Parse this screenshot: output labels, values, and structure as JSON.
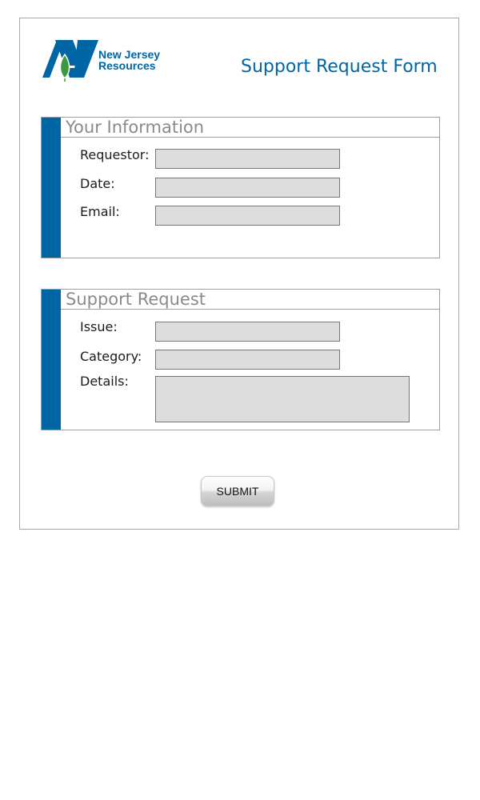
{
  "logo": {
    "line1": "New Jersey",
    "line2": "Resources",
    "brand_color": "#0065a4",
    "leaf_color": "#3a9a3d"
  },
  "page_title": "Support Request Form",
  "sections": {
    "your_information": {
      "title": "Your Information",
      "fields": {
        "requestor": {
          "label": "Requestor:",
          "value": ""
        },
        "date": {
          "label": "Date:",
          "value": ""
        },
        "email": {
          "label": "Email:",
          "value": ""
        }
      }
    },
    "support_request": {
      "title": "Support Request",
      "fields": {
        "issue": {
          "label": "Issue:",
          "value": ""
        },
        "category": {
          "label": "Category:",
          "value": ""
        },
        "details": {
          "label": "Details:",
          "value": ""
        }
      }
    }
  },
  "submit_label": "SUBMIT",
  "colors": {
    "accent": "#0065a4",
    "field_bg": "#dddddd",
    "section_title": "#8a8a8a"
  }
}
